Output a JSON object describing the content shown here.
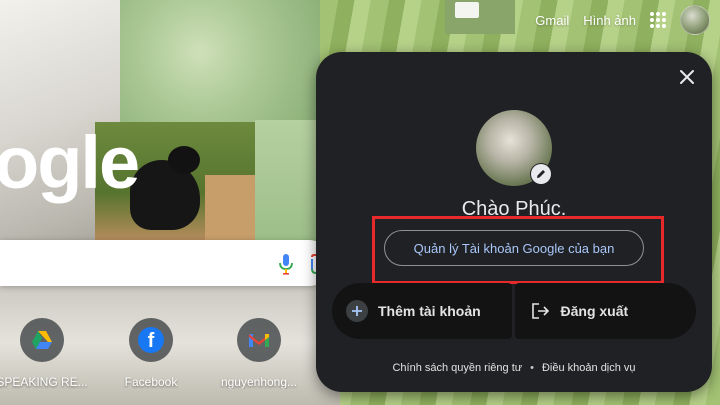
{
  "header": {
    "gmail_label": "Gmail",
    "images_label": "Hình ảnh"
  },
  "background": {
    "logo_fragment": "ogle"
  },
  "shortcuts": [
    {
      "label": "SPEAKING RE...",
      "icon": "google-drive-icon"
    },
    {
      "label": "Facebook",
      "icon": "facebook-icon"
    },
    {
      "label": "nguyenhong...",
      "icon": "gmail-icon"
    }
  ],
  "account_popup": {
    "greeting": "Chào Phúc.",
    "manage_account_label": "Quản lý Tài khoản Google của bạn",
    "add_account_label": "Thêm tài khoản",
    "sign_out_label": "Đăng xuất",
    "privacy_policy_label": "Chính sách quyền riêng tư",
    "terms_label": "Điều khoản dịch vụ",
    "separator": "•"
  },
  "colors": {
    "popup_bg": "#202124",
    "highlight_border": "#e8292b",
    "link_blue": "#a8c7fa"
  }
}
